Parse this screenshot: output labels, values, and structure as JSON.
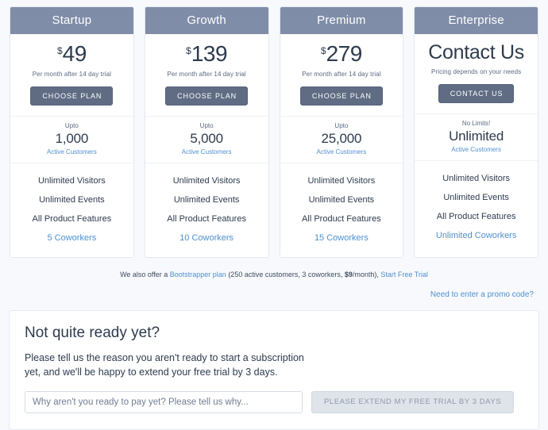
{
  "plans": [
    {
      "name": "Startup",
      "currency": "$",
      "price": "49",
      "price_sub": "Per month after 14 day trial",
      "cta": "CHOOSE PLAN",
      "quota_top": "Upto",
      "quota_value": "1,000",
      "quota_label": "Active Customers",
      "features": [
        "Unlimited Visitors",
        "Unlimited Events",
        "All Product Features"
      ],
      "coworkers": "5 Coworkers"
    },
    {
      "name": "Growth",
      "currency": "$",
      "price": "139",
      "price_sub": "Per month after 14 day trial",
      "cta": "CHOOSE PLAN",
      "quota_top": "Upto",
      "quota_value": "5,000",
      "quota_label": "Active Customers",
      "features": [
        "Unlimited Visitors",
        "Unlimited Events",
        "All Product Features"
      ],
      "coworkers": "10 Coworkers"
    },
    {
      "name": "Premium",
      "currency": "$",
      "price": "279",
      "price_sub": "Per month after 14 day trial",
      "cta": "CHOOSE PLAN",
      "quota_top": "Upto",
      "quota_value": "25,000",
      "quota_label": "Active Customers",
      "features": [
        "Unlimited Visitors",
        "Unlimited Events",
        "All Product Features"
      ],
      "coworkers": "15 Coworkers"
    },
    {
      "name": "Enterprise",
      "currency": "",
      "price": "Contact Us",
      "price_sub": "Pricing depends on your needs",
      "cta": "CONTACT US",
      "quota_top": "No Limits!",
      "quota_value": "Unlimited",
      "quota_label": "Active Customers",
      "features": [
        "Unlimited Visitors",
        "Unlimited Events",
        "All Product Features"
      ],
      "coworkers": "Unlimited Coworkers"
    }
  ],
  "note": {
    "prefix": "We also offer a ",
    "plan_link": "Bootstrapper plan",
    "details_open": " (250 active customers, 3 coworkers, ",
    "price": "$9",
    "details_close": "/month), ",
    "trial_link": "Start Free Trial"
  },
  "promo": {
    "link": "Need to enter a promo code?"
  },
  "panel": {
    "title": "Not quite ready yet?",
    "body": "Please tell us the reason you aren't ready to start a subscription yet, and we'll be happy to extend your free trial by 3 days.",
    "input_placeholder": "Why aren't you ready to pay yet? Please tell us why...",
    "input_value": "",
    "submit_label": "PLEASE EXTEND MY FREE TRIAL BY 3 DAYS"
  },
  "colors": {
    "header_slate": "#7f8da8",
    "button_slate": "#5f6c83",
    "link_blue": "#4f90d0",
    "page_bg": "#f7f9fc",
    "text_dark": "#2d3b4e"
  }
}
